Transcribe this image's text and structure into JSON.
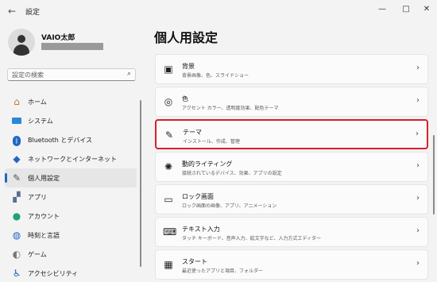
{
  "window": {
    "title": "設定",
    "back_icon": "back-arrow-icon",
    "min_icon": "—",
    "max_icon": "□",
    "close_icon": "✕"
  },
  "user": {
    "name": "VAIO太郎"
  },
  "search": {
    "placeholder": "設定の検索"
  },
  "nav": {
    "items": [
      {
        "label": "ホーム",
        "icon": "home-icon"
      },
      {
        "label": "システム",
        "icon": "monitor-icon"
      },
      {
        "label": "Bluetooth とデバイス",
        "icon": "bluetooth-icon"
      },
      {
        "label": "ネットワークとインターネット",
        "icon": "wifi-icon"
      },
      {
        "label": "個人用設定",
        "icon": "pen-icon",
        "active": true
      },
      {
        "label": "アプリ",
        "icon": "apps-icon"
      },
      {
        "label": "アカウント",
        "icon": "account-icon"
      },
      {
        "label": "時刻と言語",
        "icon": "globe-clock-icon"
      },
      {
        "label": "ゲーム",
        "icon": "gamepad-icon"
      },
      {
        "label": "アクセシビリティ",
        "icon": "accessibility-icon"
      }
    ]
  },
  "main": {
    "title": "個人用設定",
    "cards": [
      {
        "title": "背景",
        "desc": "背景画像、色、スライドショー",
        "icon": "image-icon"
      },
      {
        "title": "色",
        "desc": "アクセント カラー、透明度効果、配色テーマ",
        "icon": "palette-icon"
      },
      {
        "title": "テーマ",
        "desc": "インストール、作成、管理",
        "icon": "brush-icon",
        "highlighted": true
      },
      {
        "title": "動的ライティング",
        "desc": "接続されているデバイス、効果、アプリの設定",
        "icon": "dynamic-lighting-icon"
      },
      {
        "title": "ロック画面",
        "desc": "ロック画面の画像、アプリ、アニメーション",
        "icon": "lock-screen-icon"
      },
      {
        "title": "テキスト入力",
        "desc": "タッチ キーボード、音声入力、絵文字など、入力方式エディター",
        "icon": "keyboard-icon"
      },
      {
        "title": "スタート",
        "desc": "最近使ったアプリと項目、フォルダー",
        "icon": "start-icon"
      }
    ]
  },
  "colors": {
    "accent": "#1f67c3",
    "highlight_border": "#d81e2b"
  }
}
